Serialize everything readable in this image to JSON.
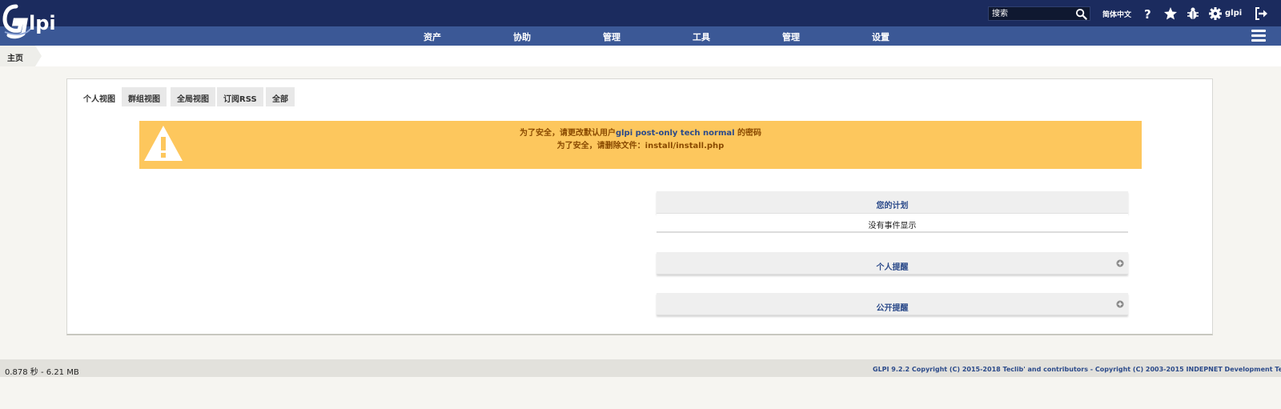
{
  "header": {
    "logo_text": "Glpi",
    "search_placeholder": "搜索",
    "language": "简体中文",
    "username": "glpi",
    "icons": [
      "help-icon",
      "star-icon",
      "bug-icon",
      "gear-icon",
      "logout-icon"
    ]
  },
  "menu": {
    "items": [
      {
        "label": "资产"
      },
      {
        "label": "协助"
      },
      {
        "label": "管理"
      },
      {
        "label": "工具"
      },
      {
        "label": "管理"
      },
      {
        "label": "设置"
      }
    ]
  },
  "breadcrumb": {
    "home": "主页"
  },
  "tabs": [
    {
      "label": "个人视图",
      "active": true
    },
    {
      "label": "群组视图"
    },
    {
      "label": "全局视图"
    },
    {
      "label": "订阅RSS"
    },
    {
      "label": "全部"
    }
  ],
  "alert": {
    "line1_prefix": "为了安全，请更改默认用户",
    "line1_users": "glpi post-only tech normal",
    "line1_suffix": " 的密码",
    "line2": "为了安全，请删除文件：install/install.php"
  },
  "planning": {
    "title": "您的计划",
    "empty": "没有事件显示"
  },
  "reminders": {
    "personal_title": "个人提醒",
    "public_title": "公开提醒"
  },
  "footer": {
    "stats": "0.878 秒 - 6.21 MB",
    "copyright": "GLPI 9.2.2 Copyright (C) 2015-2018 Teclib' and contributors - Copyright (C) 2003-2015 INDEPNET Development Team"
  },
  "colors": {
    "topbar": "#1b2b5e",
    "navbar": "#3b5896",
    "alert_bg": "#fdc75d",
    "link": "#2b4a8a"
  }
}
